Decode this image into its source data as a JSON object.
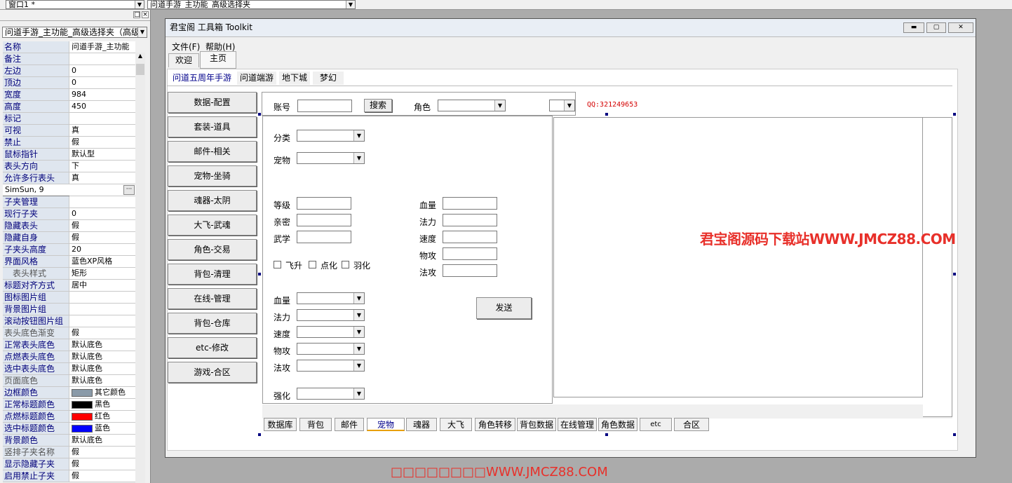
{
  "top": {
    "window_combo": "窗口1 *",
    "component_combo": "问道手游_主功能_高级选择夹"
  },
  "panel": {
    "selector": "问道手游_主功能_高级选择夹（高级",
    "properties": [
      {
        "name": "名称",
        "value": "问道手游_主功能"
      },
      {
        "name": "备注",
        "value": ""
      },
      {
        "name": "左边",
        "value": "0"
      },
      {
        "name": "顶边",
        "value": "0"
      },
      {
        "name": "宽度",
        "value": "984"
      },
      {
        "name": "高度",
        "value": "450"
      },
      {
        "name": "标记",
        "value": ""
      },
      {
        "name": "可视",
        "value": "真"
      },
      {
        "name": "禁止",
        "value": "假"
      },
      {
        "name": "鼠标指针",
        "value": "默认型"
      },
      {
        "name": "表头方向",
        "value": "下"
      },
      {
        "name": "允许多行表头",
        "value": "真"
      },
      {
        "name": "字体",
        "value": "SimSun, 9"
      },
      {
        "name": "子夹管理",
        "value": ""
      },
      {
        "name": "现行子夹",
        "value": "0"
      },
      {
        "name": "隐藏表头",
        "value": "假"
      },
      {
        "name": "隐藏自身",
        "value": "假"
      },
      {
        "name": "子夹头高度",
        "value": "20"
      },
      {
        "name": "界面风格",
        "value": "蓝色XP风格"
      },
      {
        "name": "表头样式",
        "value": "矩形"
      },
      {
        "name": "标题对齐方式",
        "value": "居中"
      },
      {
        "name": "图标图片组",
        "value": ""
      },
      {
        "name": "背景图片组",
        "value": ""
      },
      {
        "name": "滚动按钮图片组",
        "value": ""
      },
      {
        "name": "表头底色渐变",
        "value": "假"
      },
      {
        "name": "正常表头底色",
        "value": "默认底色"
      },
      {
        "name": "点燃表头底色",
        "value": "默认底色"
      },
      {
        "name": "选中表头底色",
        "value": "默认底色"
      },
      {
        "name": "页面底色",
        "value": "默认底色"
      },
      {
        "name": "边框颜色",
        "value": "其它颜色"
      },
      {
        "name": "正常标题颜色",
        "value": "黑色"
      },
      {
        "name": "点燃标题颜色",
        "value": "红色"
      },
      {
        "name": "选中标题颜色",
        "value": "蓝色"
      },
      {
        "name": "背景颜色",
        "value": "默认底色"
      },
      {
        "name": "竖排子夹名称",
        "value": "假"
      },
      {
        "name": "显示隐藏子夹",
        "value": "假"
      },
      {
        "name": "启用禁止子夹",
        "value": "假"
      }
    ]
  },
  "colors": {
    "border_swatch": "#8a9aa8",
    "black": "#000000",
    "red": "#ff0000",
    "blue": "#0000ff",
    "selected_row": "#0a3d91",
    "watermark": "#e8302a"
  },
  "form": {
    "title": "君宝阁 工具箱 Toolkit",
    "menu_file": "文件(F)",
    "menu_help": "帮助(H)",
    "tab_welcome": "欢迎",
    "tab_home": "主页",
    "game_tabs": [
      "问道五周年手游",
      "问道端游",
      "地下城",
      "梦幻"
    ],
    "side_buttons": [
      "数据-配置",
      "套装-道具",
      "邮件-相关",
      "宠物-坐骑",
      "魂器-太阴",
      "大飞-武魂",
      "角色-交易",
      "背包-清理",
      "在线-管理",
      "背包-仓库",
      "etc-修改",
      "游戏-合区"
    ],
    "account_label": "账号",
    "search_btn": "搜索",
    "role_label": "角色",
    "qq": "QQ:321249653",
    "category_label": "分类",
    "pet_label": "宠物",
    "left_stats": [
      "等级",
      "亲密",
      "武学"
    ],
    "right_stats": [
      "血量",
      "法力",
      "速度",
      "物攻",
      "法攻"
    ],
    "checks": [
      "飞升",
      "点化",
      "羽化"
    ],
    "select_stats": [
      "血量",
      "法力",
      "速度",
      "物攻",
      "法攻"
    ],
    "enhance_label": "强化",
    "send_btn": "发送",
    "watermark": "君宝阁源码下载站WWW.JMCZ88.COM",
    "bottom_tabs": [
      "数据库",
      "背包",
      "邮件",
      "宠物",
      "魂器",
      "大飞",
      "角色转移",
      "背包数据",
      "在线管理",
      "角色数据",
      "etc",
      "合区"
    ]
  },
  "footer_watermark": "□□□□□□□□WWW.JMCZ88.COM"
}
